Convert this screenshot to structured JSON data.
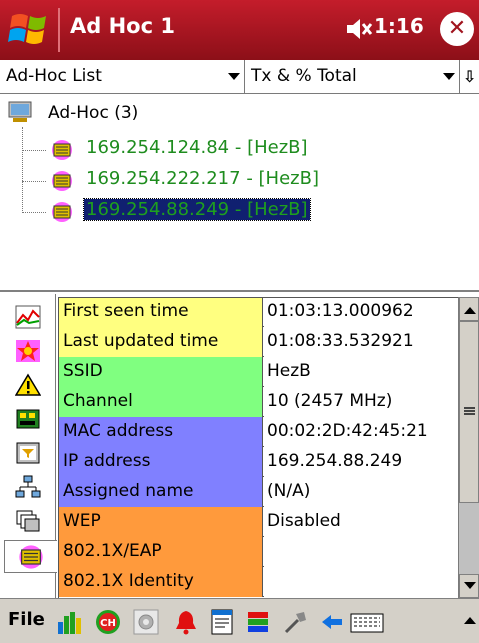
{
  "titlebar": {
    "title": "Ad Hoc 1",
    "clock": "1:16",
    "close_symbol": "✕",
    "bg_color": "#b01823"
  },
  "dropdowns": {
    "view": "Ad-Hoc List",
    "metric": "Tx & % Total",
    "extra_icon": "⇩"
  },
  "tree": {
    "root": "Ad-Hoc (3)",
    "items": [
      {
        "label": "169.254.124.84 - [HezB]",
        "selected": false
      },
      {
        "label": "169.254.222.217 - [HezB]",
        "selected": false
      },
      {
        "label": "169.254.88.249 - [HezB]",
        "selected": true
      }
    ]
  },
  "details": [
    {
      "label": "First seen time",
      "value": "01:03:13.000962",
      "color": "#ffff80"
    },
    {
      "label": "Last updated time",
      "value": "01:08:33.532921",
      "color": "#ffff80"
    },
    {
      "label": "SSID",
      "value": "HezB",
      "color": "#80ff80"
    },
    {
      "label": "Channel",
      "value": "10 (2457 MHz)",
      "color": "#80ff80"
    },
    {
      "label": "MAC address",
      "value": "00:02:2D:42:45:21",
      "color": "#8080ff"
    },
    {
      "label": "IP address",
      "value": "169.254.88.249",
      "color": "#8080ff"
    },
    {
      "label": "Assigned name",
      "value": "(N/A)",
      "color": "#8080ff"
    },
    {
      "label": "WEP",
      "value": "Disabled",
      "color": "#ff9a3c"
    },
    {
      "label": "802.1X/EAP",
      "value": "",
      "color": "#ff9a3c"
    },
    {
      "label": "802.1X Identity",
      "value": "",
      "color": "#ff9a3c"
    }
  ],
  "side_tabs": [
    "graph-icon",
    "alert-burst-icon",
    "warning-icon",
    "network-card-icon",
    "filter-icon",
    "network-tree-icon",
    "windows-icon",
    "adhoc-nodes-icon"
  ],
  "toolbar": {
    "file_label": "File",
    "icons": [
      "signal-bars-icon",
      "channel-icon",
      "settings-icon",
      "bell-icon",
      "document-icon",
      "color-bars-icon",
      "tools-icon",
      "back-arrow-icon",
      "keyboard-icon"
    ]
  }
}
